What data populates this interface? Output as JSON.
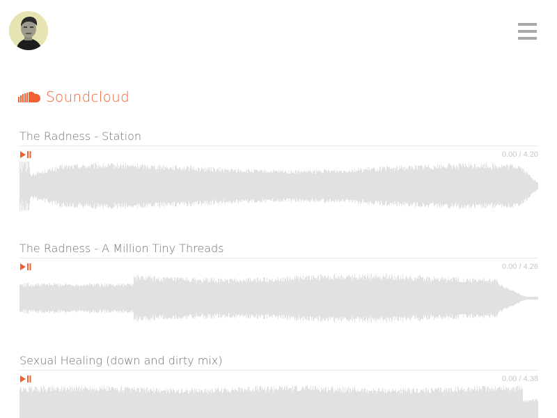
{
  "header": {
    "avatar_icon": "user-avatar",
    "menu_icon": "hamburger-menu-icon"
  },
  "section": {
    "title": "Soundcloud",
    "icon": "soundcloud-logo-icon",
    "accent_color": "#f26033"
  },
  "tracks": [
    {
      "title": "The Radness - Station",
      "time": "0.00 / 4.20"
    },
    {
      "title": "The Radness - A Million Tiny Threads",
      "time": "0.00 / 4.26"
    },
    {
      "title": "Sexual Healing (down and dirty mix)",
      "time": "0.00 / 4.38"
    }
  ],
  "waveform_color": "#e1e1e1"
}
